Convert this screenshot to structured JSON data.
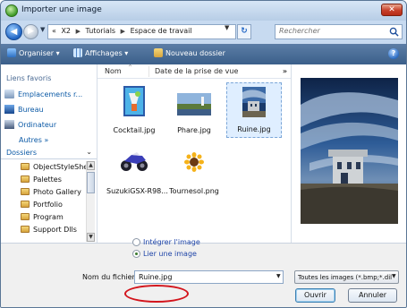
{
  "window": {
    "title": "Importer une image",
    "close_glyph": "✕"
  },
  "address": {
    "breadcrumb": [
      "«",
      "X2",
      "Tutorials",
      "Espace de travail"
    ],
    "search_placeholder": "Rechercher"
  },
  "toolbar": {
    "organize": "Organiser",
    "views": "Affichages",
    "new_folder": "Nouveau dossier",
    "help": "?"
  },
  "nav": {
    "favorites_header": "Liens favoris",
    "favorites": [
      "Emplacements r...",
      "Bureau",
      "Ordinateur"
    ],
    "more": "Autres »",
    "folders_header": "Dossiers",
    "folders": [
      "ObjectStyleShe",
      "Palettes",
      "Photo Gallery",
      "Portfolio",
      "Program",
      "Support Dlls"
    ]
  },
  "columns": {
    "name": "Nom",
    "date": "Date de la prise de vue",
    "more": "»"
  },
  "files": [
    {
      "name": "Cocktail.jpg",
      "icon": "cocktail-thumb"
    },
    {
      "name": "Phare.jpg",
      "icon": "lighthouse-thumb"
    },
    {
      "name": "Ruine.jpg",
      "icon": "ruin-thumb",
      "selected": true
    },
    {
      "name": "SuzukiGSX-R98...",
      "icon": "motorcycle-thumb"
    },
    {
      "name": "Tournesol.png",
      "icon": "sunflower-thumb"
    }
  ],
  "options": {
    "embed": "Intégrer l'image",
    "link": "Lier une image",
    "selected": "link"
  },
  "footer": {
    "filename_label": "Nom du fichier :",
    "filename_value": "Ruine.jpg",
    "file_type": "Toutes les images (*.bmp;*.dil",
    "open": "Ouvrir",
    "cancel": "Annuler"
  },
  "colors": {
    "toolbar": "#3b5f8a",
    "annotation": "#d3151d"
  }
}
